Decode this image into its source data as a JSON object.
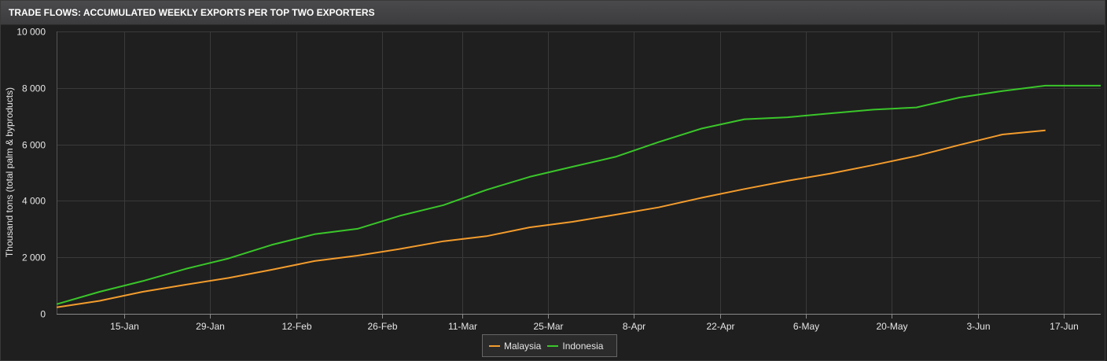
{
  "header": {
    "title": "TRADE FLOWS: ACCUMULATED WEEKLY EXPORTS PER TOP TWO EXPORTERS"
  },
  "colors": {
    "background": "#1f1f1f",
    "grid": "#3a3a3a",
    "malaysia": "#f39c2d",
    "indonesia": "#3ac62a"
  },
  "chart_data": {
    "type": "line",
    "title": "TRADE FLOWS: ACCUMULATED WEEKLY EXPORTS PER TOP TWO EXPORTERS",
    "xlabel": "",
    "ylabel": "Thousand tons (total palm & byproducts)",
    "ylim": [
      0,
      10000
    ],
    "xlim": [
      "2018-01-04",
      "2018-06-23"
    ],
    "grid": true,
    "legend_position": "bottom-center",
    "x_ticks": [
      "15-Jan",
      "29-Jan",
      "12-Feb",
      "26-Feb",
      "11-Mar",
      "25-Mar",
      "8-Apr",
      "22-Apr",
      "6-May",
      "20-May",
      "3-Jun",
      "17-Jun"
    ],
    "x_tick_dates": [
      "2018-01-15",
      "2018-01-29",
      "2018-02-12",
      "2018-02-26",
      "2018-03-11",
      "2018-03-25",
      "2018-04-08",
      "2018-04-22",
      "2018-05-06",
      "2018-05-20",
      "2018-06-03",
      "2018-06-17"
    ],
    "y_ticks": [
      "0",
      "2 000",
      "4 000",
      "6 000",
      "8 000",
      "10 000"
    ],
    "y_tick_values": [
      0,
      2000,
      4000,
      6000,
      8000,
      10000
    ],
    "series": [
      {
        "name": "Malaysia",
        "color": "#f39c2d",
        "x": [
          "2018-01-04",
          "2018-01-11",
          "2018-01-18",
          "2018-01-25",
          "2018-02-01",
          "2018-02-08",
          "2018-02-15",
          "2018-02-22",
          "2018-03-01",
          "2018-03-08",
          "2018-03-15",
          "2018-03-22",
          "2018-03-29",
          "2018-04-05",
          "2018-04-12",
          "2018-04-19",
          "2018-04-26",
          "2018-05-03",
          "2018-05-10",
          "2018-05-17",
          "2018-05-24",
          "2018-05-31",
          "2018-06-07",
          "2018-06-14"
        ],
        "values": [
          230,
          460,
          780,
          1030,
          1270,
          1560,
          1870,
          2060,
          2300,
          2570,
          2750,
          3060,
          3260,
          3510,
          3770,
          4110,
          4420,
          4710,
          4970,
          5270,
          5590,
          5980,
          6350,
          6500
        ]
      },
      {
        "name": "Indonesia",
        "color": "#3ac62a",
        "x": [
          "2018-01-04",
          "2018-01-11",
          "2018-01-18",
          "2018-01-25",
          "2018-02-01",
          "2018-02-08",
          "2018-02-15",
          "2018-02-22",
          "2018-03-01",
          "2018-03-08",
          "2018-03-15",
          "2018-03-22",
          "2018-03-29",
          "2018-04-05",
          "2018-04-12",
          "2018-04-19",
          "2018-04-26",
          "2018-05-03",
          "2018-05-10",
          "2018-05-17",
          "2018-05-24",
          "2018-05-31",
          "2018-06-07",
          "2018-06-14",
          "2018-06-23"
        ],
        "values": [
          340,
          780,
          1160,
          1590,
          1960,
          2440,
          2820,
          3010,
          3480,
          3850,
          4390,
          4850,
          5210,
          5560,
          6080,
          6560,
          6890,
          6960,
          7100,
          7230,
          7310,
          7660,
          7890,
          8080,
          8080
        ]
      }
    ]
  }
}
